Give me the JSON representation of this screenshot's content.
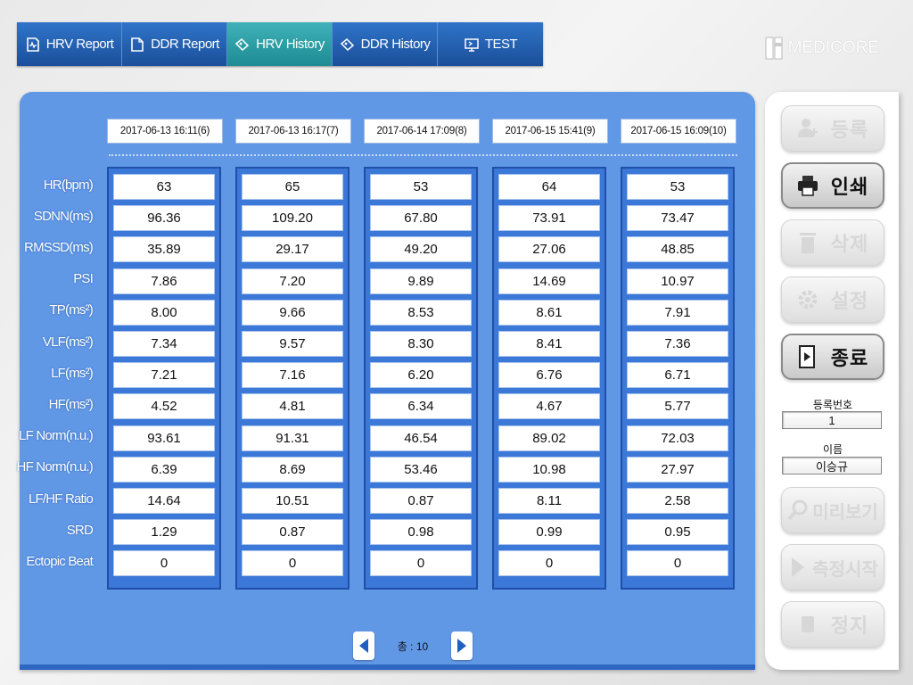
{
  "tabs": [
    {
      "label": "HRV Report",
      "icon": "hrv-report-icon",
      "active": false
    },
    {
      "label": "DDR Report",
      "icon": "ddr-report-icon",
      "active": false
    },
    {
      "label": "HRV History",
      "icon": "hrv-history-icon",
      "active": true
    },
    {
      "label": "DDR History",
      "icon": "ddr-history-icon",
      "active": false
    },
    {
      "label": "TEST",
      "icon": "test-monitor-icon",
      "active": false
    }
  ],
  "logo": {
    "text": "MEDICORE"
  },
  "table": {
    "row_labels": [
      "HR(bpm)",
      "SDNN(ms)",
      "RMSSD(ms)",
      "PSI",
      "TP(ms²)",
      "VLF(ms²)",
      "LF(ms²)",
      "HF(ms²)",
      "LF Norm(n.u.)",
      "HF Norm(n.u.)",
      "LF/HF Ratio",
      "SRD",
      "Ectopic Beat"
    ],
    "columns": [
      {
        "date": "2017-06-13 16:11(6)",
        "values": [
          "63",
          "96.36",
          "35.89",
          "7.86",
          "8.00",
          "7.34",
          "7.21",
          "4.52",
          "93.61",
          "6.39",
          "14.64",
          "1.29",
          "0"
        ]
      },
      {
        "date": "2017-06-13 16:17(7)",
        "values": [
          "65",
          "109.20",
          "29.17",
          "7.20",
          "9.66",
          "9.57",
          "7.16",
          "4.81",
          "91.31",
          "8.69",
          "10.51",
          "0.87",
          "0"
        ]
      },
      {
        "date": "2017-06-14 17:09(8)",
        "values": [
          "53",
          "67.80",
          "49.20",
          "9.89",
          "8.53",
          "8.30",
          "6.20",
          "6.34",
          "46.54",
          "53.46",
          "0.87",
          "0.98",
          "0"
        ]
      },
      {
        "date": "2017-06-15 15:41(9)",
        "values": [
          "64",
          "73.91",
          "27.06",
          "14.69",
          "8.61",
          "8.41",
          "6.76",
          "4.67",
          "89.02",
          "10.98",
          "8.11",
          "0.99",
          "0"
        ]
      },
      {
        "date": "2017-06-15 16:09(10)",
        "values": [
          "53",
          "73.47",
          "48.85",
          "10.97",
          "7.91",
          "7.36",
          "6.71",
          "5.77",
          "72.03",
          "27.97",
          "2.58",
          "0.95",
          "0"
        ]
      }
    ]
  },
  "pager": {
    "total_text": "총 : 10"
  },
  "side": {
    "buttons": [
      {
        "label": "등록",
        "icon": "add-user-icon",
        "enabled": false
      },
      {
        "label": "인쇄",
        "icon": "printer-icon",
        "enabled": true
      },
      {
        "label": "삭제",
        "icon": "trash-icon",
        "enabled": false
      },
      {
        "label": "설정",
        "icon": "gear-icon",
        "enabled": false
      },
      {
        "label": "종료",
        "icon": "exit-icon",
        "enabled": true
      }
    ],
    "reg_label": "등록번호",
    "reg_value": "1",
    "name_label": "이름",
    "name_value": "이승규",
    "bottom_buttons": [
      {
        "label": "미리보기",
        "icon": "magnifier-icon",
        "enabled": false
      },
      {
        "label": "측정시작",
        "icon": "play-icon",
        "enabled": false
      },
      {
        "label": "정지",
        "icon": "stop-icon",
        "enabled": false
      }
    ]
  },
  "colors": {
    "tab_blue": "#1b4f9b",
    "tab_active": "#1d8b93",
    "panel_blue": "#6198e6",
    "column_blue": "#3b78d8"
  }
}
